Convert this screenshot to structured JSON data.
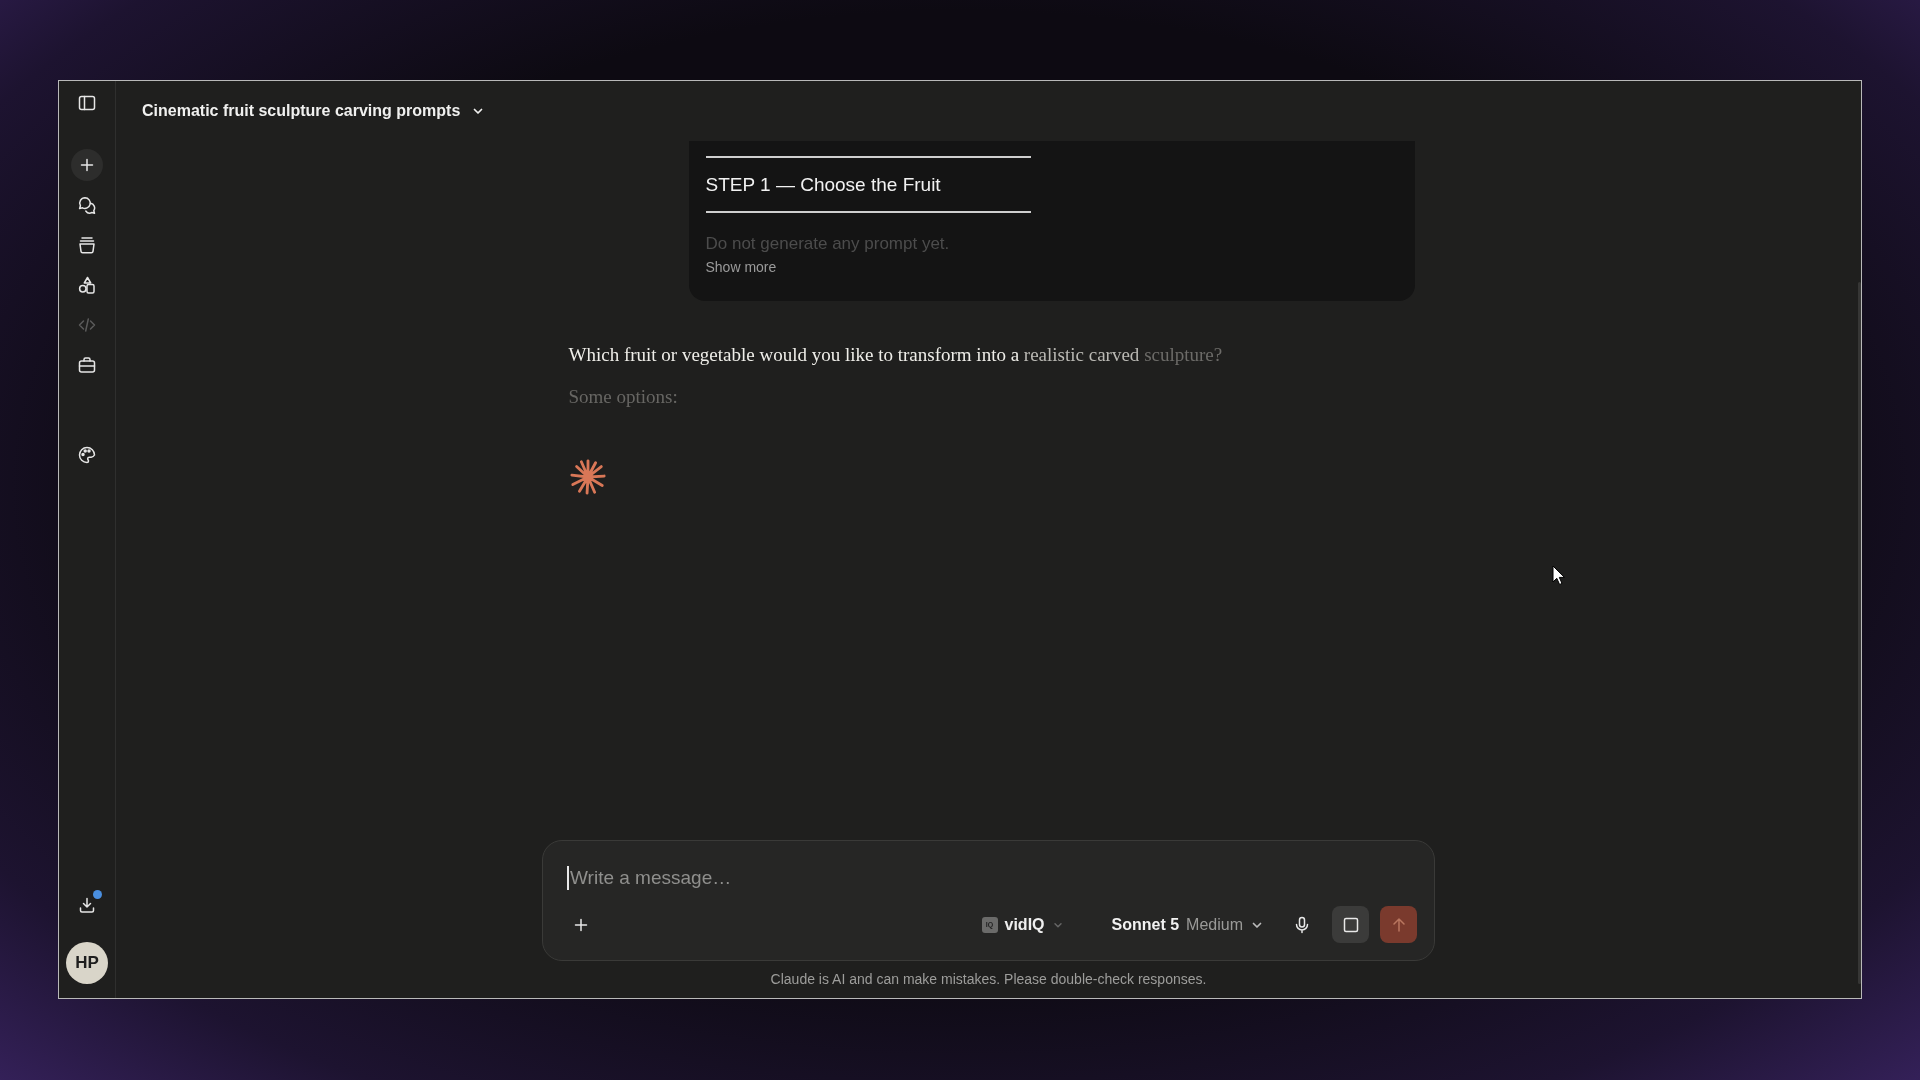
{
  "sidebar": {
    "nav": [
      {
        "kind": "new-chat",
        "disabled": false
      },
      {
        "kind": "chats",
        "disabled": false
      },
      {
        "kind": "projects",
        "disabled": false
      },
      {
        "kind": "artifacts",
        "disabled": false
      },
      {
        "kind": "code",
        "disabled": true
      },
      {
        "kind": "tools",
        "disabled": false
      }
    ],
    "nav_lower": [
      {
        "kind": "customize",
        "disabled": false
      }
    ],
    "download": {
      "badge": true
    },
    "avatar": {
      "initials": "HP"
    }
  },
  "header": {
    "title": "Cinematic fruit sculpture carving prompts"
  },
  "user_message": {
    "heading": "STEP 1 — Choose the Fruit",
    "preview": "Do not generate any prompt yet.",
    "collapsed": true,
    "show_more": "Show more"
  },
  "response": {
    "segments": [
      {
        "text": "Which fruit or vegetable would you like to transform into a",
        "kind": "settled"
      },
      {
        "text": "realistic carved",
        "kind": "fading"
      },
      {
        "text": "sculpture?",
        "kind": "faint"
      }
    ],
    "subtext": "Some options:",
    "streaming": true
  },
  "composer": {
    "placeholder": "Write a message…",
    "focused": true,
    "tool": {
      "logo": "IQ",
      "name": "vidIQ"
    },
    "model": "Sonnet 5",
    "effort": "Medium",
    "send_disabled": true
  },
  "disclaimer": "Claude is AI and can make mistakes. Please double-check responses."
}
